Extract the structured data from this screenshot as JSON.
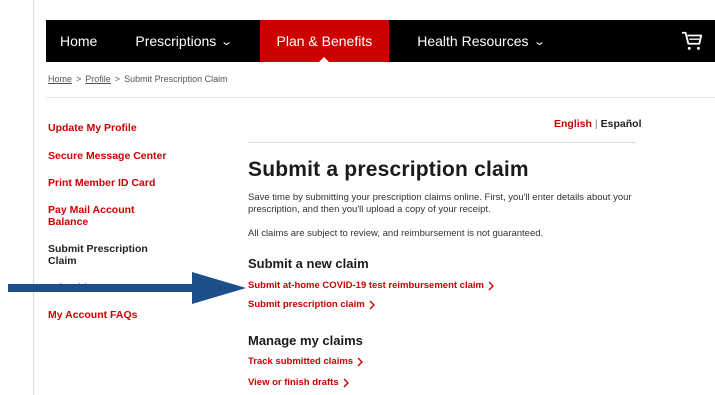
{
  "nav": {
    "items": [
      {
        "label": "Home"
      },
      {
        "label": "Prescriptions",
        "dropdown": true
      },
      {
        "label": "Plan & Benefits",
        "active": true
      },
      {
        "label": "Health Resources",
        "dropdown": true
      }
    ],
    "cart_icon": "cart-icon",
    "colors": {
      "bar": "#000000",
      "active": "#cc0000"
    }
  },
  "breadcrumb": {
    "items": [
      "Home",
      "Profile",
      "Submit Prescription Claim"
    ],
    "separator": ">"
  },
  "sidebar": {
    "items": [
      {
        "label": "Update My Profile"
      },
      {
        "label": "Secure Message Center"
      },
      {
        "label": "Print Member ID Card"
      },
      {
        "label": "Pay Mail Account Balance"
      },
      {
        "label": "Submit Prescription Claim",
        "current": true
      },
      {
        "label": "Printable Forms"
      },
      {
        "label": "My Account FAQs"
      }
    ]
  },
  "language": {
    "english": "English",
    "separator": "|",
    "spanish": "Español"
  },
  "main": {
    "title": "Submit a prescription claim",
    "intro": "Save time by submitting your prescription claims online. First, you'll enter details about your prescription, and then you'll upload a copy of your receipt.",
    "disclaimer": "All claims are subject to review, and reimbursement is not guaranteed.",
    "new_claim": {
      "heading": "Submit a new claim",
      "links": [
        "Submit at-home COVID-19 test reimbursement claim",
        "Submit prescription claim"
      ]
    },
    "manage": {
      "heading": "Manage my claims",
      "links": [
        "Track submitted claims",
        "View or finish drafts"
      ]
    }
  },
  "annotation": {
    "pointer_icon": "arrow-right-icon",
    "color": "#1f4e8c"
  }
}
